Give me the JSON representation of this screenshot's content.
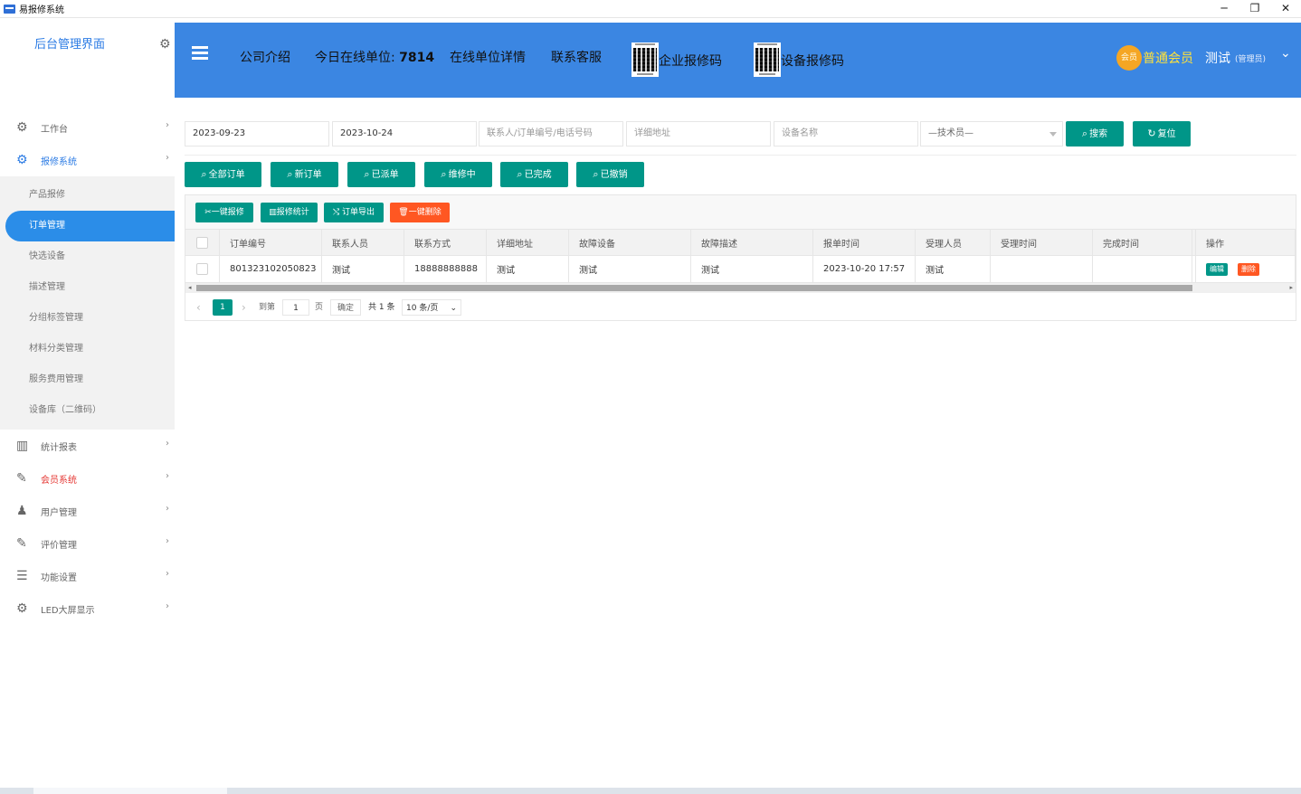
{
  "window": {
    "title": "易报修系统",
    "minimize": "─",
    "restore": "❐",
    "close": "✕"
  },
  "sidebar": {
    "logo_text": "后台管理界面",
    "items": [
      {
        "label": "工作台",
        "icon": "gears-icon"
      },
      {
        "label": "报修系统",
        "icon": "gears-icon"
      },
      {
        "label": "统计报表",
        "icon": "bar-chart-icon"
      },
      {
        "label": "会员系统",
        "icon": "edit-icon"
      },
      {
        "label": "用户管理",
        "icon": "users-icon"
      },
      {
        "label": "评价管理",
        "icon": "edit-icon"
      },
      {
        "label": "功能设置",
        "icon": "sliders-icon"
      },
      {
        "label": "LED大屏显示",
        "icon": "gears-icon"
      }
    ],
    "sub_items": [
      "产品报修",
      "订单管理",
      "快选设备",
      "描述管理",
      "分组标签管理",
      "材料分类管理",
      "服务费用管理",
      "设备库（二维码）"
    ],
    "active_sub": "订单管理"
  },
  "header": {
    "nav_company": "公司介绍",
    "online_label": "今日在线单位:",
    "online_count": "7814",
    "online_detail": "在线单位详情",
    "contact": "联系客服",
    "enterprise_qr": "企业报修码",
    "device_qr": "设备报修码",
    "vip_badge": "会员",
    "vip_level": "普通会员",
    "user_name": "测试",
    "user_role": "(管理员)"
  },
  "filters": {
    "date_start": "2023-09-23",
    "date_end": "2023-10-24",
    "keyword_placeholder": "联系人/订单编号/电话号码",
    "address_placeholder": "详细地址",
    "device_placeholder": "设备名称",
    "technician": "—技术员—",
    "search": "搜索",
    "reset": "复位"
  },
  "status_tabs": [
    "全部订单",
    "新订单",
    "已派单",
    "维修中",
    "已完成",
    "已撤销"
  ],
  "toolbar": {
    "quick_repair": "一键报修",
    "stats": "报修统计",
    "export": "订单导出",
    "delete_all": "一键删除"
  },
  "table": {
    "columns": [
      "订单编号",
      "联系人员",
      "联系方式",
      "详细地址",
      "故障设备",
      "故障描述",
      "报单时间",
      "受理人员",
      "受理时间",
      "完成时间",
      "操作"
    ],
    "rows": [
      {
        "order_no": "801323102050823",
        "contact": "测试",
        "phone": "18888888888",
        "address": "测试",
        "device": "测试",
        "desc": "测试",
        "time": "2023-10-20 17:57",
        "handler": "测试",
        "accept_time": "",
        "finish_time": "",
        "edit": "编辑",
        "delete": "删除"
      }
    ]
  },
  "pager": {
    "prev": "‹",
    "next": "›",
    "current": "1",
    "goto": "到第",
    "page_input": "1",
    "page_unit": "页",
    "confirm": "确定",
    "total": "共 1 条",
    "per_page": "10 条/页"
  }
}
